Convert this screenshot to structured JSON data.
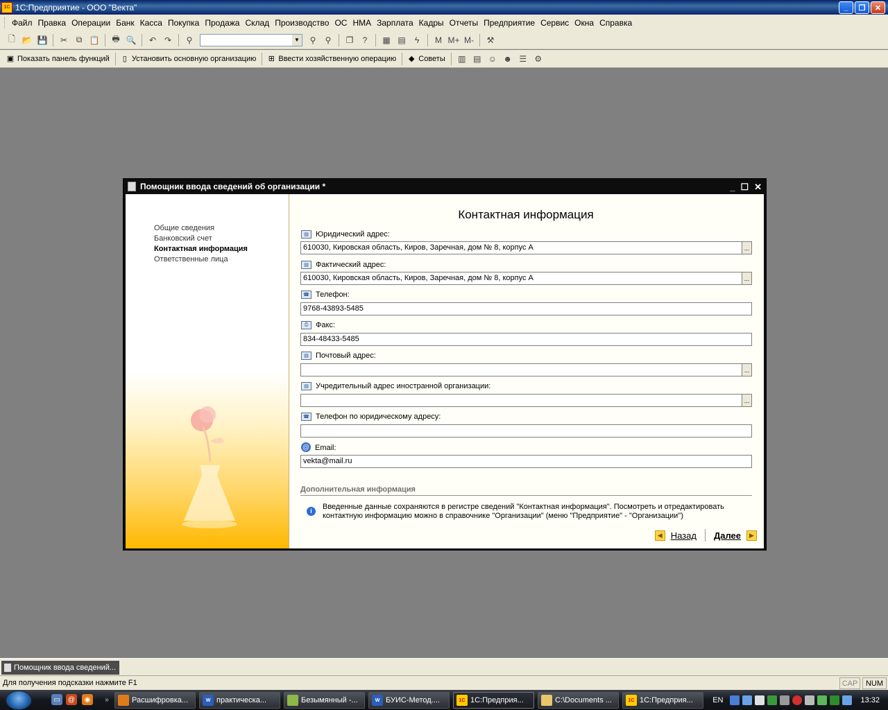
{
  "app": {
    "title": "1С:Предприятие - ООО \"Векта\"",
    "logo_text": "1С V8"
  },
  "menu": [
    "Файл",
    "Правка",
    "Операции",
    "Банк",
    "Касса",
    "Покупка",
    "Продажа",
    "Склад",
    "Производство",
    "ОС",
    "НМА",
    "Зарплата",
    "Кадры",
    "Отчеты",
    "Предприятие",
    "Сервис",
    "Окна",
    "Справка"
  ],
  "toolbar2": {
    "show_panel": "Показать панель функций",
    "set_org": "Установить основную организацию",
    "enter_op": "Ввести хозяйственную операцию",
    "tips": "Советы"
  },
  "dialog": {
    "title": "Помощник ввода сведений об организации *",
    "steps": [
      "Общие сведения",
      "Банковский счет",
      "Контактная информация",
      "Ответственные лица"
    ],
    "heading": "Контактная информация",
    "fields": {
      "legal_label": "Юридический адрес:",
      "legal_value": "610030, Кировская область, Киров, Заречная, дом № 8, корпус А",
      "actual_label": "Фактический адрес:",
      "actual_value": "610030, Кировская область, Киров, Заречная, дом № 8, корпус А",
      "phone_label": "Телефон:",
      "phone_value": "9768-43893-5485",
      "fax_label": "Факс:",
      "fax_value": "834-48433-5485",
      "postal_label": "Почтовый адрес:",
      "postal_value": "",
      "founder_label": "Учредительный адрес иностранной организации:",
      "founder_value": "",
      "legalphone_label": "Телефон по юридическому адресу:",
      "legalphone_value": "",
      "email_label": "Email:",
      "email_value": "vekta@mail.ru"
    },
    "section": "Дополнительная информация",
    "info_text": "Введенные данные сохраняются в регистре сведений \"Контактная информация\". Посмотреть и отредактировать контактную информацию можно в справочнике \"Организации\" (меню \"Предприятие\" - \"Организации\")",
    "back": "Назад",
    "next": "Далее"
  },
  "window_tab": "Помощник ввода сведений...",
  "status": {
    "hint": "Для получения подсказки нажмите F1",
    "cap": "CAP",
    "num": "NUM"
  },
  "taskbar": {
    "buttons": [
      "Расшифровка...",
      "практическа...",
      "Безымянный -...",
      "БУИС-Метод....",
      "1С:Предприя...",
      "C:\\Documents ...",
      "1С:Предприя..."
    ],
    "lang": "EN",
    "clock": "13:32"
  }
}
